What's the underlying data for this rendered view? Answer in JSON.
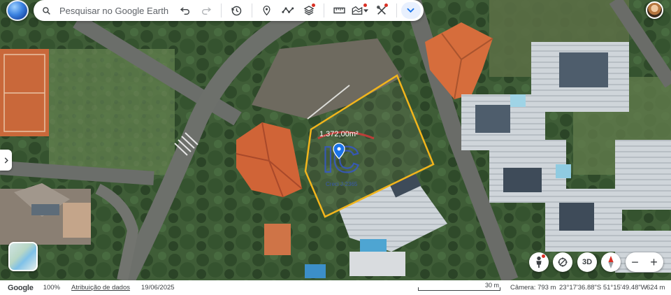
{
  "search": {
    "placeholder": "Pesquisar no Google Earth"
  },
  "toolbar": {
    "buttons": [
      "undo-icon",
      "redo-icon",
      "history-icon",
      "placemark-icon",
      "path-icon",
      "layers-icon",
      "ruler-icon",
      "map-style-icon",
      "tools-icon"
    ],
    "expand_icon": "chevron-down-icon"
  },
  "map": {
    "area_label": "1.372,00m²",
    "watermark_logo": "IC",
    "watermark_text": "Creci J-2365",
    "polygon_color": "#f2b51c",
    "pin_color": "#1a73e8"
  },
  "controls": {
    "three_d_label": "3D",
    "zoom_out": "−",
    "zoom_in": "+"
  },
  "status": {
    "brand": "Google",
    "zoom_pct": "100%",
    "attribution": "Atribuição de dados",
    "date": "19/06/2025",
    "scale_label": "30 m",
    "camera": "Câmera: 793 m",
    "coords": "23°17'36.88\"S 51°15'49.48\"W",
    "altitude": "624 m"
  },
  "colors": {
    "accent": "#1a73e8",
    "notification_dot": "#d93025"
  }
}
